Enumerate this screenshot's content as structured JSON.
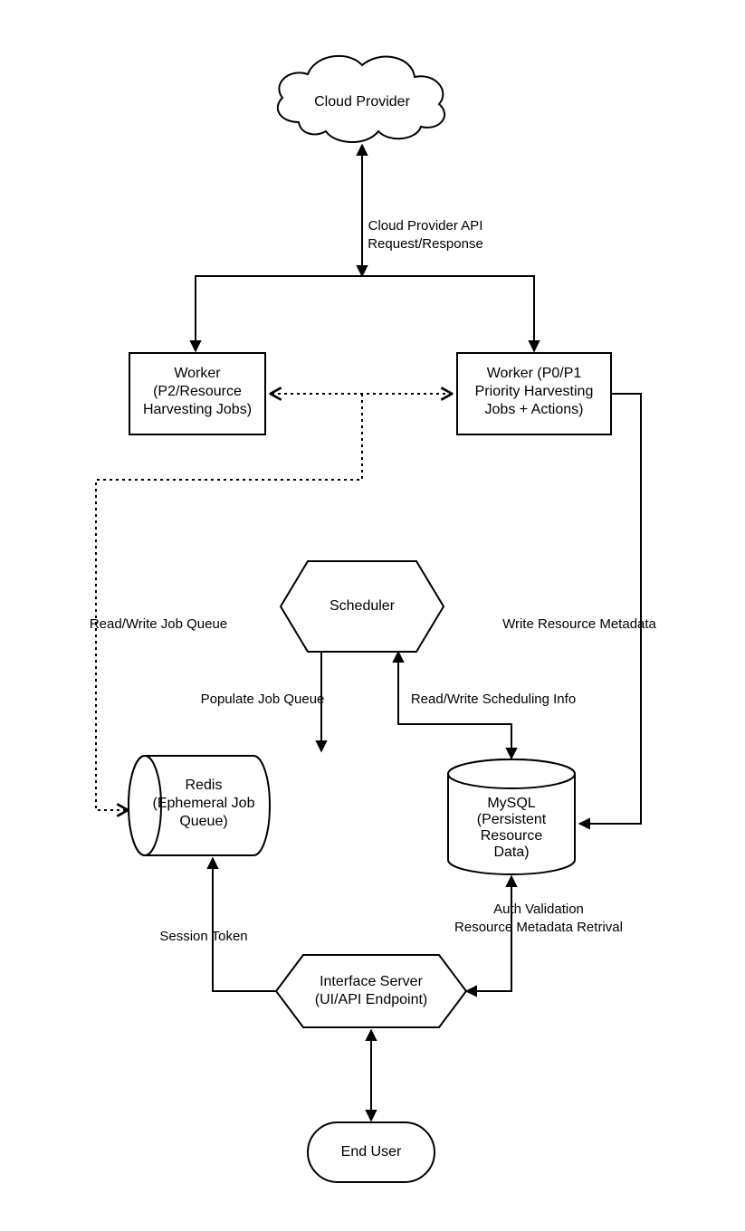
{
  "nodes": {
    "cloud": {
      "label": "Cloud Provider"
    },
    "worker_left": {
      "line1": "Worker",
      "line2": "(P2/Resource",
      "line3": "Harvesting Jobs)"
    },
    "worker_right": {
      "line1": "Worker (P0/P1",
      "line2": "Priority Harvesting",
      "line3": "Jobs + Actions)"
    },
    "scheduler": {
      "label": "Scheduler"
    },
    "redis": {
      "line1": "Redis",
      "line2": "(Ephemeral Job",
      "line3": "Queue)"
    },
    "mysql": {
      "line1": "MySQL",
      "line2": "(Persistent",
      "line3": "Resource",
      "line4": "Data)"
    },
    "interface": {
      "line1": "Interface Server",
      "line2": "(UI/API Endpoint)"
    },
    "enduser": {
      "label": "End User"
    }
  },
  "edges": {
    "cloud_api": {
      "line1": "Cloud Provider API",
      "line2": "Request/Response"
    },
    "rw_job_queue": {
      "label": "Read/Write Job Queue"
    },
    "populate": {
      "label": "Populate Job Queue"
    },
    "rw_sched": {
      "label": "Read/Write Scheduling Info"
    },
    "write_meta": {
      "label": "Write Resource Metadata"
    },
    "session": {
      "label": "Session Token"
    },
    "auth": {
      "line1": "Auth Validation",
      "line2": "Resource Metadata Retrival"
    }
  }
}
